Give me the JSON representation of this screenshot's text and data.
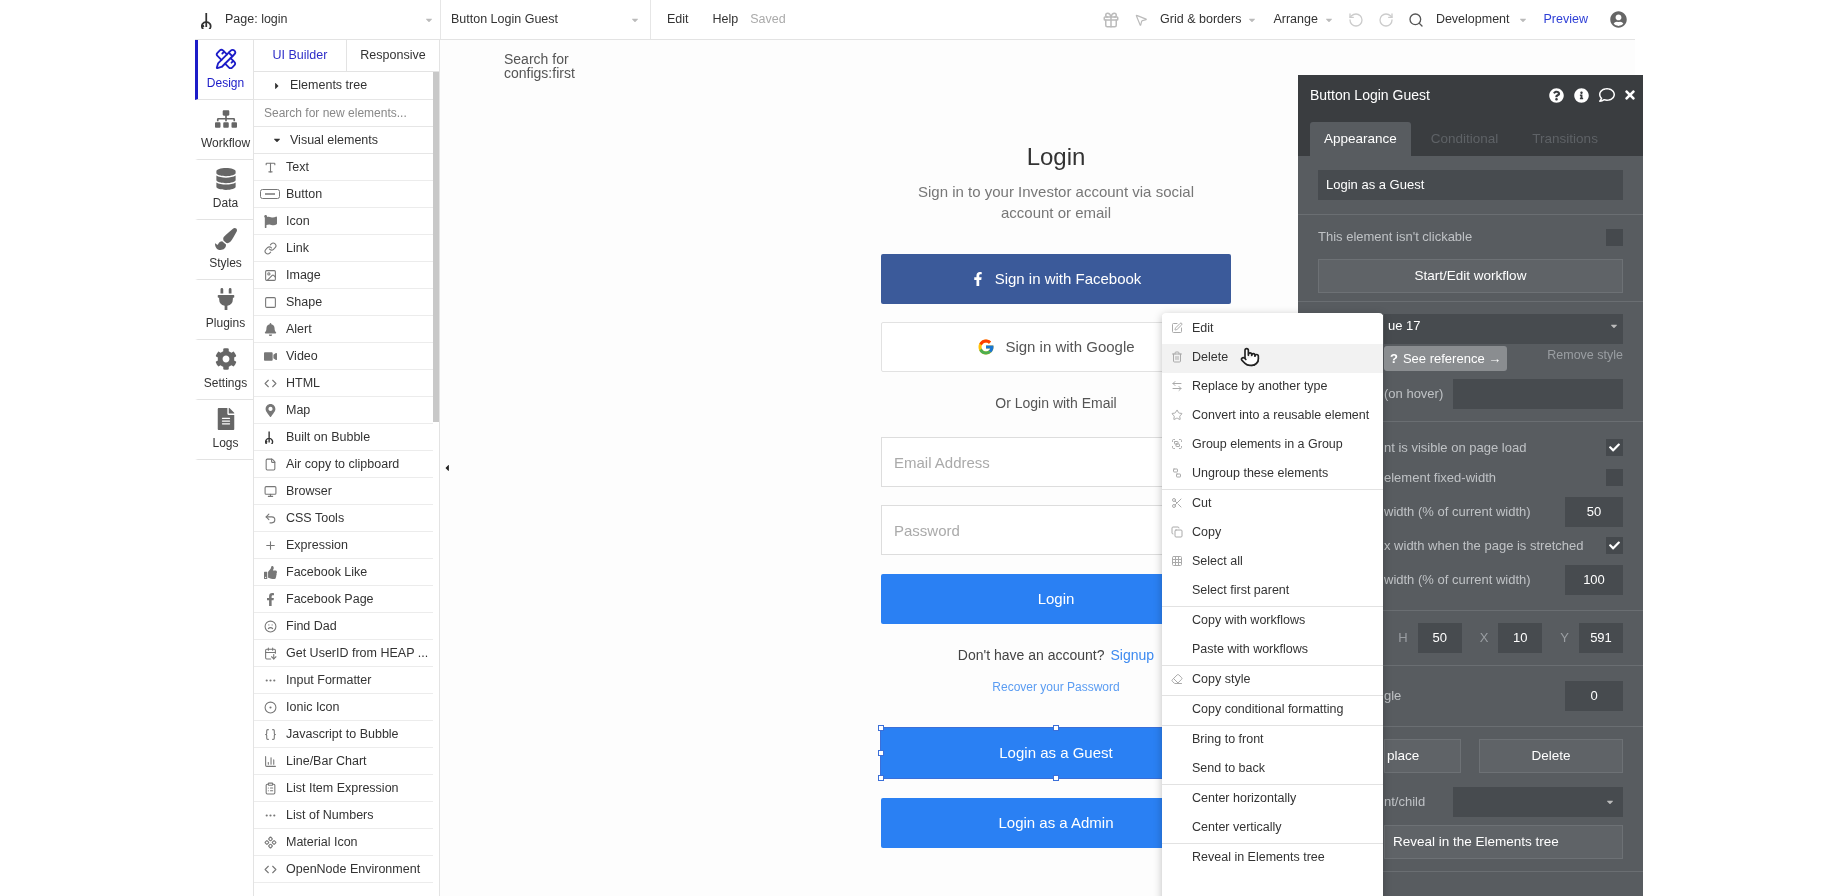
{
  "topbar": {
    "page_selector": "Page: login",
    "element_selector": "Button Login Guest",
    "menu": [
      "Edit",
      "Help"
    ],
    "save_status": "Saved",
    "grid_menu": "Grid & borders",
    "arrange_menu": "Arrange",
    "version_selector": "Development",
    "preview_link": "Preview"
  },
  "rail": [
    {
      "label": "Design",
      "selected": true
    },
    {
      "label": "Workflow",
      "selected": false
    },
    {
      "label": "Data",
      "selected": false
    },
    {
      "label": "Styles",
      "selected": false
    },
    {
      "label": "Plugins",
      "selected": false
    },
    {
      "label": "Settings",
      "selected": false
    },
    {
      "label": "Logs",
      "selected": false
    }
  ],
  "elements_panel": {
    "tabs": [
      {
        "label": "UI Builder",
        "selected": true
      },
      {
        "label": "Responsive",
        "selected": false
      }
    ],
    "tree": {
      "label": "Elements tree",
      "expanded": false
    },
    "search": {
      "placeholder": "Search for new elements..."
    },
    "section": {
      "label": "Visual elements",
      "expanded": true
    },
    "items": [
      "Text",
      "Button",
      "Icon",
      "Link",
      "Image",
      "Shape",
      "Alert",
      "Video",
      "HTML",
      "Map",
      "Built on Bubble",
      "Air copy to clipboard",
      "Browser",
      "CSS Tools",
      "Expression",
      "Facebook Like",
      "Facebook Page",
      "Find Dad",
      "Get UserID from HEAP ...",
      "Input Formatter",
      "Ionic Icon",
      "Javascript to Bubble",
      "Line/Bar Chart",
      "List Item Expression",
      "List of Numbers",
      "Material Icon",
      "OpenNode Environment"
    ]
  },
  "canvas": {
    "search_text": "Search for configs:first",
    "title": "Login",
    "subtitle": "Sign in to your Investor account via social account or email",
    "facebook_button": "Sign in with Facebook",
    "google_button": "Sign in with Google",
    "divider_text": "Or Login with Email",
    "email": {
      "placeholder": "Email Address"
    },
    "password": {
      "placeholder": "Password"
    },
    "login_button": "Login",
    "signup_prompt": "Don't have an account?",
    "signup_link": "Signup",
    "recover_link": "Recover your Password",
    "guest_button": {
      "label": "Login as a Guest",
      "selected": true
    },
    "admin_button": {
      "label": "Login as a Admin",
      "selected": false
    }
  },
  "context_menu": {
    "groups": [
      [
        {
          "label": "Edit",
          "hovered": false
        },
        {
          "label": "Delete",
          "hovered": true
        },
        {
          "label": "Replace by another type",
          "hovered": false
        },
        {
          "label": "Convert into a reusable element",
          "hovered": false
        },
        {
          "label": "Group elements in a Group",
          "hovered": false
        },
        {
          "label": "Ungroup these elements",
          "hovered": false
        }
      ],
      [
        {
          "label": "Cut",
          "hovered": false
        },
        {
          "label": "Copy",
          "hovered": false
        },
        {
          "label": "Select all",
          "hovered": false
        },
        {
          "label": "Select first parent",
          "hovered": false
        }
      ],
      [
        {
          "label": "Copy with workflows",
          "hovered": false
        },
        {
          "label": "Paste with workflows",
          "hovered": false
        }
      ],
      [
        {
          "label": "Copy style",
          "hovered": false
        }
      ],
      [
        {
          "label": "Copy conditional formatting",
          "hovered": false
        }
      ],
      [
        {
          "label": "Bring to front",
          "hovered": false
        },
        {
          "label": "Send to back",
          "hovered": false
        }
      ],
      [
        {
          "label": "Center horizontally",
          "hovered": false
        },
        {
          "label": "Center vertically",
          "hovered": false
        }
      ],
      [
        {
          "label": "Reveal in Elements tree",
          "hovered": false
        }
      ]
    ]
  },
  "properties": {
    "title": "Button Login Guest",
    "tabs": [
      {
        "label": "Appearance",
        "selected": true
      },
      {
        "label": "Conditional",
        "selected": false
      },
      {
        "label": "Transitions",
        "selected": false
      }
    ],
    "tooltip": {
      "mark": "?",
      "label": "See reference →"
    },
    "sections": [
      [
        {
          "kind": "text_field",
          "value": "Login as a Guest"
        }
      ],
      [
        {
          "kind": "check",
          "label": "This element isn't clickable",
          "checked": false
        },
        {
          "kind": "button",
          "label": "Start/Edit workflow"
        }
      ],
      [
        {
          "kind": "dropdown",
          "value": "ue 17"
        },
        {
          "kind": "link",
          "label": "Remove style"
        },
        {
          "kind": "wide_field",
          "label": "(on hover)"
        }
      ],
      [
        {
          "kind": "check",
          "label": "nt is visible on page load",
          "checked": true
        },
        {
          "kind": "check",
          "label": "element fixed-width",
          "checked": false
        },
        {
          "kind": "number",
          "label": "width (% of current width)",
          "value": "50"
        },
        {
          "kind": "check",
          "label": "x width when the page is stretched",
          "checked": true
        },
        {
          "kind": "number",
          "label": "width (% of current width)",
          "value": "100"
        }
      ],
      [
        {
          "kind": "dims",
          "fields": [
            {
              "label": "H",
              "value": "50"
            },
            {
              "label": "X",
              "value": "10"
            },
            {
              "label": "Y",
              "value": "591"
            }
          ]
        }
      ],
      [
        {
          "kind": "number",
          "label": "gle",
          "value": "0"
        }
      ],
      [
        {
          "kind": "button_pair",
          "buttons": [
            "place",
            "Delete"
          ]
        },
        {
          "kind": "wide_dropdown",
          "label": "nt/child"
        },
        {
          "kind": "button",
          "label": "Reveal in the Elements tree"
        }
      ]
    ]
  }
}
